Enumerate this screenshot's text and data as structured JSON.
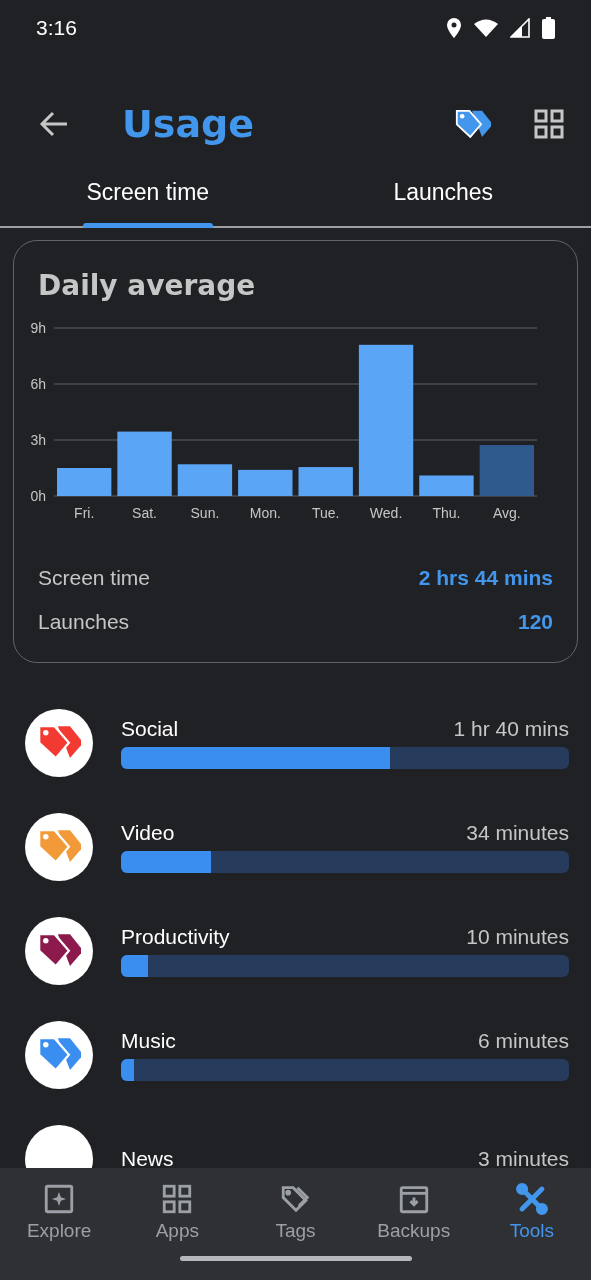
{
  "status_bar": {
    "time": "3:16"
  },
  "header": {
    "title": "Usage"
  },
  "tabs": [
    {
      "label": "Screen time",
      "selected": true
    },
    {
      "label": "Launches",
      "selected": false
    }
  ],
  "summary": {
    "title": "Daily average",
    "chart_data": {
      "type": "bar",
      "categories": [
        "Fri.",
        "Sat.",
        "Sun.",
        "Mon.",
        "Tue.",
        "Wed.",
        "Thu.",
        "Avg."
      ],
      "ylim": [
        0,
        9
      ],
      "yticks": [
        {
          "value": 0,
          "label": "0h"
        },
        {
          "value": 3,
          "label": "3h"
        },
        {
          "value": 6,
          "label": "6h"
        },
        {
          "value": 9,
          "label": "9h"
        }
      ],
      "series": [
        {
          "color": "#5aa5f5",
          "values": [
            1.5,
            3.45,
            1.7,
            1.4,
            1.55,
            8.1,
            1.1,
            null
          ]
        },
        {
          "color": "#2e5a8e",
          "values": [
            null,
            null,
            null,
            null,
            null,
            null,
            null,
            2.73
          ]
        }
      ]
    },
    "stats": [
      {
        "label": "Screen time",
        "value": "2 hrs 44 mins"
      },
      {
        "label": "Launches",
        "value": "120"
      }
    ]
  },
  "categories": [
    {
      "name": "Social",
      "time": "1 hr 40 mins",
      "level": 0.6,
      "color": "#f23a33"
    },
    {
      "name": "Video",
      "time": "34 minutes",
      "level": 0.2,
      "color": "#f29a38"
    },
    {
      "name": "Productivity",
      "time": "10 minutes",
      "level": 0.06,
      "color": "#8c1a4c"
    },
    {
      "name": "Music",
      "time": "6 minutes",
      "level": 0.03,
      "color": "#3a8ef0"
    },
    {
      "name": "News",
      "time": "3 minutes"
    }
  ],
  "nav": [
    {
      "label": "Explore",
      "selected": false
    },
    {
      "label": "Apps",
      "selected": false
    },
    {
      "label": "Tags",
      "selected": false
    },
    {
      "label": "Backups",
      "selected": false
    },
    {
      "label": "Tools",
      "selected": true
    }
  ]
}
